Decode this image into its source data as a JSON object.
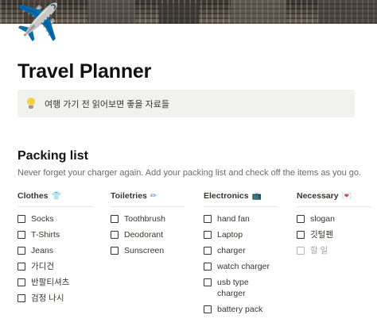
{
  "page": {
    "icon": "airplane-icon",
    "title": "Travel Planner",
    "callout": {
      "icon": "lightbulb-icon",
      "text": "여행 가기 전 읽어보면 좋을 자료들"
    }
  },
  "packing": {
    "title": "Packing list",
    "description": "Never forget your charger again. Add your packing list and check off the items as you go.",
    "columns": [
      {
        "label": "Clothes",
        "icon": "t-shirt-icon",
        "items": [
          "Socks",
          "T-Shirts",
          "Jeans",
          "가디건",
          "반팔티셔츠",
          "검정 나시"
        ]
      },
      {
        "label": "Toiletries",
        "icon": "toothbrush-icon",
        "items": [
          "Toothbrush",
          "Deodorant",
          "Sunscreen"
        ]
      },
      {
        "label": "Electronics",
        "icon": "television-icon",
        "items": [
          "hand fan",
          "Laptop",
          "charger",
          "watch charger",
          "usb type charger",
          "battery pack"
        ]
      },
      {
        "label": "Necessary",
        "icon": "heart-icon",
        "items": [
          "slogan",
          "깃털펜"
        ],
        "placeholder": "할 일"
      }
    ]
  },
  "colors": {
    "text": "#37352f",
    "callout_bg": "#f1f1ef",
    "muted": "#a5a4a0"
  }
}
